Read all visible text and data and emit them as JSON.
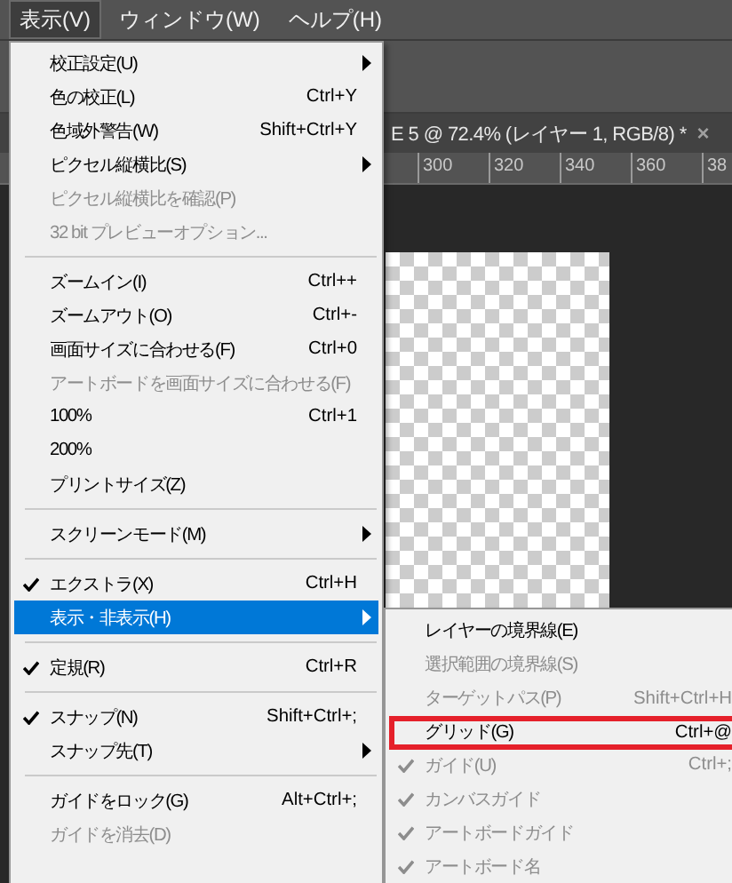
{
  "menubar": [
    {
      "label": "表示(V)",
      "selected": true
    },
    {
      "label": "ウィンドウ(W)",
      "selected": false
    },
    {
      "label": "ヘルプ(H)",
      "selected": false
    }
  ],
  "document_tab": {
    "title": "E 5 @ 72.4% (レイヤー 1, RGB/8) *",
    "close": "×"
  },
  "ruler": {
    "labels": [
      "300",
      "320",
      "340",
      "360",
      "38"
    ]
  },
  "menu": [
    {
      "kind": "item",
      "label": "校正設定(U)",
      "submenu": true,
      "checked": false,
      "disabled": false,
      "selected": false
    },
    {
      "kind": "item",
      "label": "色の校正(L)",
      "shortcut": "Ctrl+Y",
      "submenu": false,
      "checked": false,
      "disabled": false,
      "selected": false
    },
    {
      "kind": "item",
      "label": "色域外警告(W)",
      "shortcut": "Shift+Ctrl+Y",
      "submenu": false,
      "checked": false,
      "disabled": false,
      "selected": false
    },
    {
      "kind": "item",
      "label": "ピクセル縦横比(S)",
      "submenu": true,
      "checked": false,
      "disabled": false,
      "selected": false
    },
    {
      "kind": "item",
      "label": "ピクセル縦横比を確認(P)",
      "submenu": false,
      "checked": false,
      "disabled": true,
      "selected": false
    },
    {
      "kind": "item",
      "label": "32 bit プレビューオプション...",
      "submenu": false,
      "checked": false,
      "disabled": true,
      "selected": false
    },
    {
      "kind": "separator"
    },
    {
      "kind": "item",
      "label": "ズームイン(I)",
      "shortcut": "Ctrl++",
      "submenu": false,
      "checked": false,
      "disabled": false,
      "selected": false
    },
    {
      "kind": "item",
      "label": "ズームアウト(O)",
      "shortcut": "Ctrl+-",
      "submenu": false,
      "checked": false,
      "disabled": false,
      "selected": false
    },
    {
      "kind": "item",
      "label": "画面サイズに合わせる(F)",
      "shortcut": "Ctrl+0",
      "submenu": false,
      "checked": false,
      "disabled": false,
      "selected": false
    },
    {
      "kind": "item",
      "label": "アートボードを画面サイズに合わせる(F)",
      "submenu": false,
      "checked": false,
      "disabled": true,
      "selected": false
    },
    {
      "kind": "item",
      "label": "100%",
      "shortcut": "Ctrl+1",
      "submenu": false,
      "checked": false,
      "disabled": false,
      "selected": false
    },
    {
      "kind": "item",
      "label": "200%",
      "submenu": false,
      "checked": false,
      "disabled": false,
      "selected": false
    },
    {
      "kind": "item",
      "label": "プリントサイズ(Z)",
      "submenu": false,
      "checked": false,
      "disabled": false,
      "selected": false
    },
    {
      "kind": "separator"
    },
    {
      "kind": "item",
      "label": "スクリーンモード(M)",
      "submenu": true,
      "checked": false,
      "disabled": false,
      "selected": false
    },
    {
      "kind": "separator"
    },
    {
      "kind": "item",
      "label": "エクストラ(X)",
      "shortcut": "Ctrl+H",
      "submenu": false,
      "checked": true,
      "disabled": false,
      "selected": false
    },
    {
      "kind": "item",
      "label": "表示・非表示(H)",
      "submenu": true,
      "checked": false,
      "disabled": false,
      "selected": true
    },
    {
      "kind": "separator"
    },
    {
      "kind": "item",
      "label": "定規(R)",
      "shortcut": "Ctrl+R",
      "submenu": false,
      "checked": true,
      "disabled": false,
      "selected": false
    },
    {
      "kind": "separator"
    },
    {
      "kind": "item",
      "label": "スナップ(N)",
      "shortcut": "Shift+Ctrl+;",
      "submenu": false,
      "checked": true,
      "disabled": false,
      "selected": false
    },
    {
      "kind": "item",
      "label": "スナップ先(T)",
      "submenu": true,
      "checked": false,
      "disabled": false,
      "selected": false
    },
    {
      "kind": "separator"
    },
    {
      "kind": "item",
      "label": "ガイドをロック(G)",
      "shortcut": "Alt+Ctrl+;",
      "submenu": false,
      "checked": false,
      "disabled": false,
      "selected": false
    },
    {
      "kind": "item",
      "label": "ガイドを消去(D)",
      "submenu": false,
      "checked": false,
      "disabled": true,
      "selected": false
    }
  ],
  "submenu": [
    {
      "label": "レイヤーの境界線(E)",
      "checked": false,
      "disabled": false,
      "highlighted": false
    },
    {
      "label": "選択範囲の境界線(S)",
      "checked": false,
      "disabled": true,
      "highlighted": false
    },
    {
      "label": "ターゲットパス(P)",
      "shortcut": "Shift+Ctrl+H",
      "checked": false,
      "disabled": true,
      "highlighted": false
    },
    {
      "label": "グリッド(G)",
      "shortcut": "Ctrl+@",
      "checked": false,
      "disabled": false,
      "highlighted": true
    },
    {
      "label": "ガイド(U)",
      "shortcut": "Ctrl+;",
      "checked": true,
      "disabled": true,
      "highlighted": false
    },
    {
      "label": "カンバスガイド",
      "checked": true,
      "disabled": true,
      "highlighted": false
    },
    {
      "label": "アートボードガイド",
      "checked": true,
      "disabled": true,
      "highlighted": false
    },
    {
      "label": "アートボード名",
      "checked": true,
      "disabled": true,
      "highlighted": false
    }
  ]
}
